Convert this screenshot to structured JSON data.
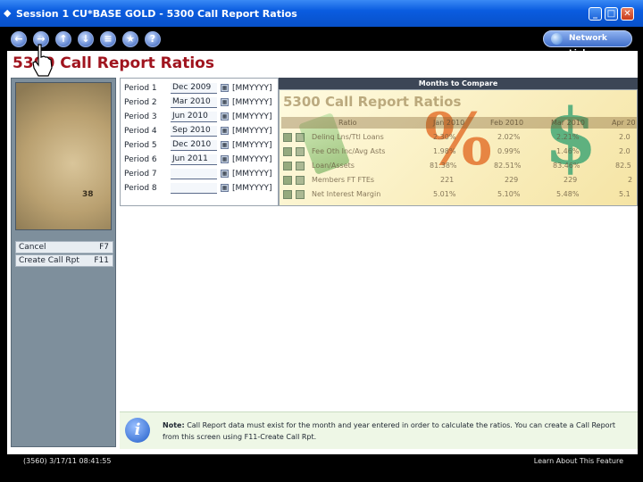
{
  "window": {
    "title": "Session 1 CU*BASE GOLD - 5300 Call Report Ratios",
    "minimize": "_",
    "maximize": "□",
    "close": "✕"
  },
  "toolbar": {
    "nav_icons": [
      "back",
      "forward",
      "up",
      "down",
      "menu",
      "favorites",
      "help"
    ],
    "network_links": "Network Links"
  },
  "page": {
    "title": "5300 Call Report Ratios"
  },
  "left_panel": {
    "photo_label": "38",
    "fkeys": [
      {
        "label": "Cancel",
        "key": "F7"
      },
      {
        "label": "Create Call Rpt",
        "key": "F11"
      }
    ]
  },
  "periods": {
    "months_header": "Months to Compare",
    "format": "[MMYYYY]",
    "rows": [
      {
        "label": "Period 1",
        "value": "Dec 2009"
      },
      {
        "label": "Period 2",
        "value": "Mar 2010"
      },
      {
        "label": "Period 3",
        "value": "Jun 2010"
      },
      {
        "label": "Period 4",
        "value": "Sep 2010"
      },
      {
        "label": "Period 5",
        "value": "Dec 2010"
      },
      {
        "label": "Period 6",
        "value": "Jun 2011"
      },
      {
        "label": "Period 7",
        "value": ""
      },
      {
        "label": "Period 8",
        "value": ""
      }
    ]
  },
  "preview": {
    "title": "5300 Call Report Ratios",
    "headers": [
      "Ratio",
      "Jan 2010",
      "Feb 2010",
      "Mar 2010",
      "Apr 20"
    ],
    "rows": [
      {
        "ratio": "Delinq Lns/Ttl Loans",
        "v1": "2.30%",
        "v2": "2.02%",
        "v3": "2.21%",
        "v4": "2.0"
      },
      {
        "ratio": "Fee Oth Inc/Avg Asts",
        "v1": "1.98%",
        "v2": "0.99%",
        "v3": "1.46%",
        "v4": "2.0"
      },
      {
        "ratio": "Loan/Assets",
        "v1": "81.38%",
        "v2": "82.51%",
        "v3": "83.46%",
        "v4": "82.5"
      },
      {
        "ratio": "Members FT FTEs",
        "v1": "221",
        "v2": "229",
        "v3": "229",
        "v4": "2"
      },
      {
        "ratio": "Net Interest Margin",
        "v1": "5.01%",
        "v2": "5.10%",
        "v3": "5.48%",
        "v4": "5.1"
      }
    ],
    "pct_glyph": "%",
    "dollar_glyph": "$"
  },
  "note": {
    "prefix": "Note:",
    "text": "Call Report data must exist for the month and year entered in order to calculate the ratios.  You can create a Call Report from this screen using F11-Create Call Rpt."
  },
  "status": {
    "left": "(3560) 3/17/11 08:41:55",
    "right": "Learn About This Feature"
  }
}
